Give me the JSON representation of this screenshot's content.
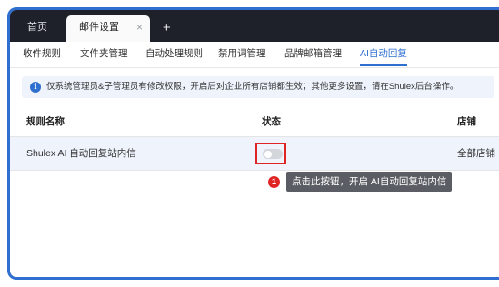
{
  "tabs": {
    "home_label": "首页",
    "mail_label": "邮件设置",
    "close_glyph": "×",
    "add_glyph": "+"
  },
  "subnav": {
    "items": [
      "收件规则",
      "文件夹管理",
      "自动处理规则",
      "禁用词管理",
      "品牌邮箱管理",
      "AI自动回复"
    ],
    "active_index": 5
  },
  "notice": {
    "icon_glyph": "i",
    "text": "仅系统管理员&子管理员有修改权限，开启后对企业所有店铺都生效；其他更多设置，请在Shulex后台操作。"
  },
  "table": {
    "headers": {
      "rule_name": "规则名称",
      "status": "状态",
      "store": "店铺"
    },
    "row": {
      "rule_name": "Shulex AI 自动回复站内信",
      "toggle_on": false,
      "store": "全部店铺"
    }
  },
  "annotation": {
    "step_number": "1",
    "tooltip": "点击此按钮，开启 AI自动回复站内信"
  },
  "colors": {
    "accent": "#2f6fd0",
    "highlight": "#e02424",
    "tabbar": "#1e2129",
    "row_bg": "#eef3fc"
  }
}
